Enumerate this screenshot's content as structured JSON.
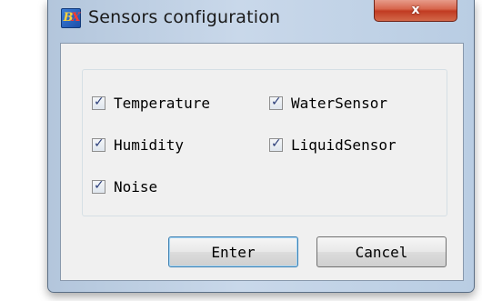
{
  "window": {
    "title": "Sensors configuration",
    "close_label": "x",
    "icon_text": "B",
    "icon_text_accent": "X"
  },
  "sensors": [
    {
      "label": "Temperature",
      "checked": true,
      "check_mark": "✓"
    },
    {
      "label": "WaterSensor",
      "checked": true,
      "check_mark": "✓"
    },
    {
      "label": "Humidity",
      "checked": true,
      "check_mark": "✓"
    },
    {
      "label": "LiquidSensor",
      "checked": true,
      "check_mark": "✓"
    },
    {
      "label": "Noise",
      "checked": true,
      "check_mark": "✓"
    }
  ],
  "buttons": {
    "enter_label": "Enter",
    "cancel_label": "Cancel"
  },
  "colors": {
    "title_close": "#c13b22",
    "default_button_border": "#3c7fb1"
  }
}
